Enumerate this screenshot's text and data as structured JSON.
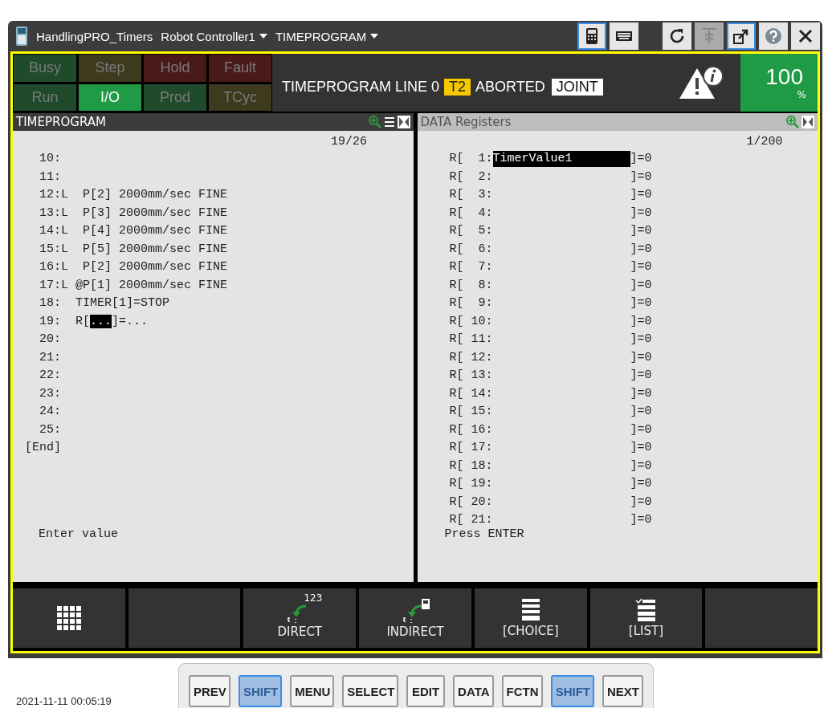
{
  "window": {
    "title_items": [
      {
        "kind": "app",
        "label": "HandlingPRO_Timers"
      },
      {
        "kind": "menu",
        "label": "Robot Controller1"
      },
      {
        "kind": "menu",
        "label": "TIMEPROGRAM"
      }
    ],
    "tools": [
      {
        "kind": "pendant",
        "selected": true,
        "disabled": false
      },
      {
        "kind": "keyboard",
        "selected": false,
        "disabled": false
      },
      {
        "kind": "refresh",
        "selected": false,
        "disabled": false
      },
      {
        "kind": "jog",
        "selected": false,
        "disabled": true
      },
      {
        "kind": "popout",
        "selected": true,
        "disabled": false
      },
      {
        "kind": "help",
        "selected": false,
        "disabled": false
      },
      {
        "kind": "close",
        "selected": false,
        "disabled": false
      }
    ]
  },
  "status_lamps": [
    {
      "label": "Busy",
      "on": false,
      "color": "#1f4a2c"
    },
    {
      "label": "Step",
      "on": false,
      "color": "#3d3a1e"
    },
    {
      "label": "Hold",
      "on": false,
      "color": "#4a1a1a"
    },
    {
      "label": "Fault",
      "on": false,
      "color": "#4a1a1a"
    },
    {
      "label": "Run",
      "on": false,
      "color": "#1f4a2c"
    },
    {
      "label": "I/O",
      "on": true,
      "color": "#1f9a45"
    },
    {
      "label": "Prod",
      "on": false,
      "color": "#1f4a2c"
    },
    {
      "label": "TCyc",
      "on": false,
      "color": "#3d3a1e"
    }
  ],
  "status_line": {
    "program": "TIMEPROGRAM LINE 0",
    "mode": "T2",
    "state": "ABORTED",
    "coord": "JOINT"
  },
  "override": {
    "value": "100",
    "unit": "%"
  },
  "program_pane": {
    "title": "TIMEPROGRAM",
    "active": true,
    "position": "19/26",
    "lines": [
      {
        "text": "   10:"
      },
      {
        "text": "   11:"
      },
      {
        "text": "   12:L  P[2] 2000mm/sec FINE"
      },
      {
        "text": "   13:L  P[3] 2000mm/sec FINE"
      },
      {
        "text": "   14:L  P[4] 2000mm/sec FINE"
      },
      {
        "text": "   15:L  P[5] 2000mm/sec FINE"
      },
      {
        "text": "   16:L  P[2] 2000mm/sec FINE"
      },
      {
        "text": "   17:L @P[1] 2000mm/sec FINE"
      },
      {
        "text": "   18:  TIMER[1]=STOP"
      },
      {
        "text": "   19:  R[",
        "cursor": "...",
        "after": "]=..."
      },
      {
        "text": "   20:"
      },
      {
        "text": "   21:"
      },
      {
        "text": "   22:"
      },
      {
        "text": "   23:"
      },
      {
        "text": "   24:"
      },
      {
        "text": "   25:"
      },
      {
        "text": " [End]"
      }
    ],
    "prompt": "Enter value"
  },
  "register_pane": {
    "title": "DATA Registers",
    "active": false,
    "position": "1/200",
    "rows": [
      {
        "index": "R[  1:",
        "comment": "TimerValue1",
        "value": "]=0",
        "selected": true
      },
      {
        "index": "R[  2:",
        "value": "]=0",
        "selected": false
      },
      {
        "index": "R[  3:",
        "value": "]=0",
        "selected": false
      },
      {
        "index": "R[  4:",
        "value": "]=0",
        "selected": false
      },
      {
        "index": "R[  5:",
        "value": "]=0",
        "selected": false
      },
      {
        "index": "R[  6:",
        "value": "]=0",
        "selected": false
      },
      {
        "index": "R[  7:",
        "value": "]=0",
        "selected": false
      },
      {
        "index": "R[  8:",
        "value": "]=0",
        "selected": false
      },
      {
        "index": "R[  9:",
        "value": "]=0",
        "selected": false
      },
      {
        "index": "R[ 10:",
        "value": "]=0",
        "selected": false
      },
      {
        "index": "R[ 11:",
        "value": "]=0",
        "selected": false
      },
      {
        "index": "R[ 12:",
        "value": "]=0",
        "selected": false
      },
      {
        "index": "R[ 13:",
        "value": "]=0",
        "selected": false
      },
      {
        "index": "R[ 14:",
        "value": "]=0",
        "selected": false
      },
      {
        "index": "R[ 15:",
        "value": "]=0",
        "selected": false
      },
      {
        "index": "R[ 16:",
        "value": "]=0",
        "selected": false
      },
      {
        "index": "R[ 17:",
        "value": "]=0",
        "selected": false
      },
      {
        "index": "R[ 18:",
        "value": "]=0",
        "selected": false
      },
      {
        "index": "R[ 19:",
        "value": "]=0",
        "selected": false
      },
      {
        "index": "R[ 20:",
        "value": "]=0",
        "selected": false
      },
      {
        "index": "R[ 21:",
        "value": "]=0",
        "selected": false
      }
    ],
    "prompt": "Press ENTER"
  },
  "function_keys": [
    {
      "kind": "grid"
    },
    {
      "kind": "empty"
    },
    {
      "kind": "direct",
      "label": "DIRECT",
      "badge": "123"
    },
    {
      "kind": "indirect",
      "label": "INDIRECT"
    },
    {
      "kind": "choice",
      "label": "[CHOICE]"
    },
    {
      "kind": "list",
      "label": "[LIST]"
    },
    {
      "kind": "empty"
    }
  ],
  "keys": [
    {
      "kind": "key",
      "label": "PREV"
    },
    {
      "kind": "shift",
      "label": "SHIFT"
    },
    {
      "kind": "key",
      "label": "MENU"
    },
    {
      "kind": "key",
      "label": "SELECT"
    },
    {
      "kind": "key",
      "label": "EDIT"
    },
    {
      "kind": "key",
      "label": "DATA"
    },
    {
      "kind": "key",
      "label": "FCTN"
    },
    {
      "kind": "shift",
      "label": "SHIFT"
    },
    {
      "kind": "key",
      "label": "NEXT"
    }
  ],
  "desktop": {
    "timestamp": "2021-11-11 00:05:19"
  }
}
